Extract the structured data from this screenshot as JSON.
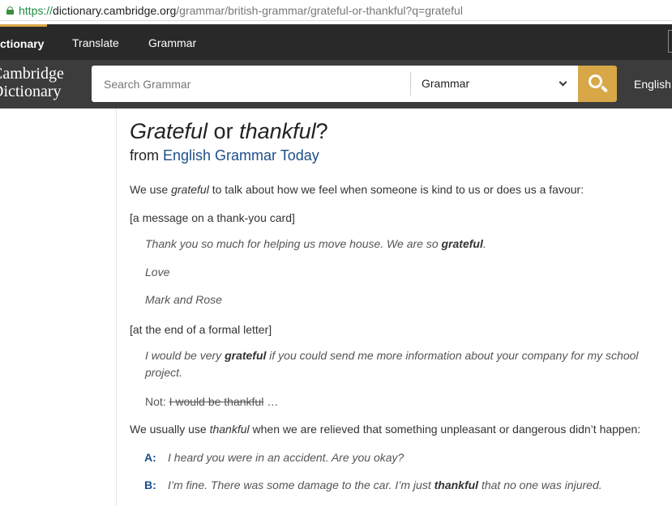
{
  "browser": {
    "url_scheme": "https://",
    "url_host": "dictionary.cambridge.org",
    "url_path": "/grammar/british-grammar/grateful-or-thankful?q=grateful"
  },
  "nav": {
    "dictionary": "ctionary",
    "translate": "Translate",
    "grammar": "Grammar"
  },
  "header": {
    "logo_line1": "Cambridge",
    "logo_line2": "Dictionary",
    "search_placeholder": "Search Grammar",
    "search_scope": "Grammar",
    "language": "English"
  },
  "article": {
    "title_a": "Grateful",
    "title_or": " or ",
    "title_b": "thankful",
    "title_q": "?",
    "from_prefix": "from ",
    "source": "English Grammar Today",
    "p1_pre": "We use ",
    "p1_word": "grateful",
    "p1_post": " to talk about how we feel when someone is kind to us or does us a favour:",
    "ctx1": "[a message on a thank-you card]",
    "ex1_pre": "Thank you so much for helping us move house. We are so ",
    "ex1_bold": "grateful",
    "ex1_post": ".",
    "ex2": "Love",
    "ex3": "Mark and Rose",
    "ctx2": "[at the end of a formal letter]",
    "ex4_pre": "I would be very ",
    "ex4_bold": "grateful",
    "ex4_post": " if you could send me more information about your company for my school project.",
    "not_label": "Not: ",
    "not_struck": "I would be thankful",
    "not_ellipsis": " …",
    "p2_pre": "We usually use ",
    "p2_word": "thankful",
    "p2_post": " when we are relieved that something unpleasant or dangerous didn’t happen:",
    "dlg_a_speaker": "A:",
    "dlg_a_text": "I heard you were in an accident. Are you okay?",
    "dlg_b_speaker": "B:",
    "dlg_b_pre": "I’m fine. There was some damage to the car. I’m just ",
    "dlg_b_bold": "thankful",
    "dlg_b_post": " that no one was injured."
  },
  "colors": {
    "accent": "#d8a748",
    "nav_bg": "#292929",
    "header_bg": "#3c3c3c",
    "link": "#1d4e8a"
  },
  "icons": {
    "lock": "lock-icon",
    "search": "search-icon",
    "dropdown": "chevron-down-icon"
  }
}
